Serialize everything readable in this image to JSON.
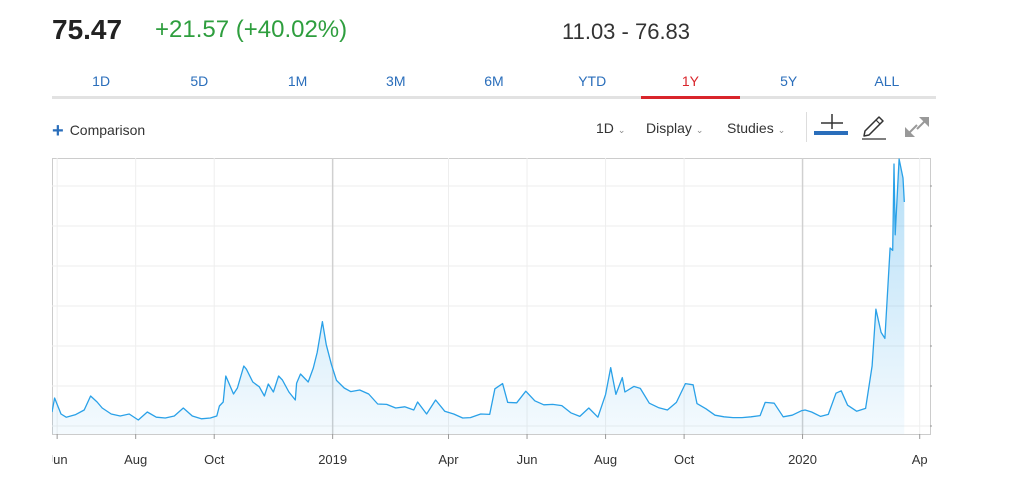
{
  "header": {
    "price": "75.47",
    "change": "+21.57 (+40.02%)",
    "range": "11.03 - 76.83"
  },
  "tabs": [
    {
      "label": "1D"
    },
    {
      "label": "5D"
    },
    {
      "label": "1M"
    },
    {
      "label": "3M"
    },
    {
      "label": "6M"
    },
    {
      "label": "YTD"
    },
    {
      "label": "1Y"
    },
    {
      "label": "5Y"
    },
    {
      "label": "ALL"
    }
  ],
  "active_tab": "1Y",
  "toolbar": {
    "comparison_label": "Comparison",
    "interval_label": "1D",
    "display_label": "Display",
    "studies_label": "Studies"
  },
  "icons": {
    "comparison": "plus-icon",
    "crosshair": "crosshair-icon",
    "draw": "pencil-icon",
    "fullscreen": "expand-icon"
  },
  "colors": {
    "accent": "#2a6ebb",
    "positive": "#2e9e3e",
    "active_tab": "#d9252b",
    "series": "#2aa1e8"
  },
  "chart_data": {
    "type": "area",
    "title": "",
    "xlabel": "",
    "ylabel": "",
    "ylim": [
      8,
      77
    ],
    "yticks": [
      "10.00",
      "20.00",
      "30.00",
      "40.00",
      "50.00",
      "60.00",
      "70.00"
    ],
    "xlim": [
      "2018-05-28",
      "2020-04-09"
    ],
    "xticks": [
      {
        "label": "Jun",
        "date": "2018-06-01"
      },
      {
        "label": "Aug",
        "date": "2018-08-01"
      },
      {
        "label": "Oct",
        "date": "2018-10-01"
      },
      {
        "label": "2019",
        "date": "2019-01-01"
      },
      {
        "label": "Apr",
        "date": "2019-04-01"
      },
      {
        "label": "Jun",
        "date": "2019-06-01"
      },
      {
        "label": "Aug",
        "date": "2019-08-01"
      },
      {
        "label": "Oct",
        "date": "2019-10-01"
      },
      {
        "label": "2020",
        "date": "2020-01-01"
      },
      {
        "label": "Ap",
        "date": "2020-04-01"
      }
    ],
    "grid": true,
    "series": [
      {
        "points": [
          [
            "2018-05-28",
            13.5
          ],
          [
            "2018-05-30",
            17.0
          ],
          [
            "2018-06-04",
            13.0
          ],
          [
            "2018-06-08",
            12.2
          ],
          [
            "2018-06-15",
            12.8
          ],
          [
            "2018-06-22",
            14.0
          ],
          [
            "2018-06-27",
            17.5
          ],
          [
            "2018-07-02",
            16.0
          ],
          [
            "2018-07-06",
            14.5
          ],
          [
            "2018-07-13",
            13.0
          ],
          [
            "2018-07-20",
            12.5
          ],
          [
            "2018-07-27",
            13.0
          ],
          [
            "2018-08-03",
            11.5
          ],
          [
            "2018-08-10",
            13.5
          ],
          [
            "2018-08-17",
            12.2
          ],
          [
            "2018-08-24",
            12.0
          ],
          [
            "2018-08-31",
            12.5
          ],
          [
            "2018-09-07",
            14.5
          ],
          [
            "2018-09-14",
            12.5
          ],
          [
            "2018-09-21",
            11.8
          ],
          [
            "2018-09-28",
            12.0
          ],
          [
            "2018-10-03",
            12.5
          ],
          [
            "2018-10-05",
            15.0
          ],
          [
            "2018-10-08",
            16.0
          ],
          [
            "2018-10-10",
            22.5
          ],
          [
            "2018-10-12",
            21.0
          ],
          [
            "2018-10-16",
            18.0
          ],
          [
            "2018-10-19",
            19.5
          ],
          [
            "2018-10-24",
            25.0
          ],
          [
            "2018-10-26",
            24.2
          ],
          [
            "2018-10-31",
            21.0
          ],
          [
            "2018-11-05",
            19.8
          ],
          [
            "2018-11-09",
            17.5
          ],
          [
            "2018-11-12",
            20.5
          ],
          [
            "2018-11-16",
            18.5
          ],
          [
            "2018-11-20",
            22.5
          ],
          [
            "2018-11-23",
            21.5
          ],
          [
            "2018-11-28",
            18.5
          ],
          [
            "2018-12-03",
            16.5
          ],
          [
            "2018-12-04",
            20.7
          ],
          [
            "2018-12-07",
            23.0
          ],
          [
            "2018-12-13",
            21.0
          ],
          [
            "2018-12-17",
            24.5
          ],
          [
            "2018-12-20",
            28.4
          ],
          [
            "2018-12-24",
            36.1
          ],
          [
            "2018-12-27",
            30.4
          ],
          [
            "2018-12-31",
            25.4
          ],
          [
            "2019-01-04",
            21.4
          ],
          [
            "2019-01-10",
            19.5
          ],
          [
            "2019-01-15",
            18.6
          ],
          [
            "2019-01-22",
            19.0
          ],
          [
            "2019-01-29",
            18.0
          ],
          [
            "2019-02-05",
            15.5
          ],
          [
            "2019-02-12",
            15.4
          ],
          [
            "2019-02-19",
            14.5
          ],
          [
            "2019-02-26",
            14.8
          ],
          [
            "2019-03-05",
            14.0
          ],
          [
            "2019-03-08",
            16.0
          ],
          [
            "2019-03-15",
            13.0
          ],
          [
            "2019-03-22",
            16.5
          ],
          [
            "2019-03-29",
            13.7
          ],
          [
            "2019-04-05",
            13.0
          ],
          [
            "2019-04-12",
            12.0
          ],
          [
            "2019-04-18",
            12.1
          ],
          [
            "2019-04-26",
            13.0
          ],
          [
            "2019-05-03",
            12.9
          ],
          [
            "2019-05-07",
            19.3
          ],
          [
            "2019-05-13",
            20.6
          ],
          [
            "2019-05-17",
            15.9
          ],
          [
            "2019-05-24",
            15.8
          ],
          [
            "2019-05-31",
            18.7
          ],
          [
            "2019-06-07",
            16.3
          ],
          [
            "2019-06-14",
            15.3
          ],
          [
            "2019-06-21",
            15.4
          ],
          [
            "2019-06-28",
            15.1
          ],
          [
            "2019-07-05",
            13.3
          ],
          [
            "2019-07-12",
            12.4
          ],
          [
            "2019-07-19",
            14.5
          ],
          [
            "2019-07-26",
            12.2
          ],
          [
            "2019-08-01",
            17.9
          ],
          [
            "2019-08-05",
            24.6
          ],
          [
            "2019-08-09",
            17.9
          ],
          [
            "2019-08-14",
            22.1
          ],
          [
            "2019-08-16",
            18.5
          ],
          [
            "2019-08-23",
            19.9
          ],
          [
            "2019-08-28",
            19.4
          ],
          [
            "2019-09-04",
            15.7
          ],
          [
            "2019-09-11",
            14.6
          ],
          [
            "2019-09-18",
            14.0
          ],
          [
            "2019-09-25",
            15.9
          ],
          [
            "2019-10-02",
            20.6
          ],
          [
            "2019-10-08",
            20.3
          ],
          [
            "2019-10-11",
            15.6
          ],
          [
            "2019-10-18",
            14.3
          ],
          [
            "2019-10-25",
            12.7
          ],
          [
            "2019-11-01",
            12.3
          ],
          [
            "2019-11-08",
            12.1
          ],
          [
            "2019-11-15",
            12.1
          ],
          [
            "2019-11-22",
            12.3
          ],
          [
            "2019-11-29",
            12.6
          ],
          [
            "2019-12-03",
            15.9
          ],
          [
            "2019-12-10",
            15.7
          ],
          [
            "2019-12-17",
            12.3
          ],
          [
            "2019-12-24",
            12.7
          ],
          [
            "2019-12-31",
            13.8
          ],
          [
            "2020-01-03",
            14.0
          ],
          [
            "2020-01-08",
            13.5
          ],
          [
            "2020-01-15",
            12.4
          ],
          [
            "2020-01-21",
            12.9
          ],
          [
            "2020-01-27",
            18.2
          ],
          [
            "2020-01-31",
            18.8
          ],
          [
            "2020-02-05",
            15.2
          ],
          [
            "2020-02-12",
            13.7
          ],
          [
            "2020-02-19",
            14.4
          ],
          [
            "2020-02-24",
            25.0
          ],
          [
            "2020-02-27",
            39.2
          ],
          [
            "2020-03-02",
            33.4
          ],
          [
            "2020-03-05",
            31.9
          ],
          [
            "2020-03-09",
            54.5
          ],
          [
            "2020-03-11",
            53.9
          ],
          [
            "2020-03-12",
            75.5
          ],
          [
            "2020-03-13",
            57.8
          ],
          [
            "2020-03-16",
            82.7
          ],
          [
            "2020-03-19",
            72.0
          ],
          [
            "2020-03-20",
            66.0
          ]
        ]
      }
    ]
  }
}
